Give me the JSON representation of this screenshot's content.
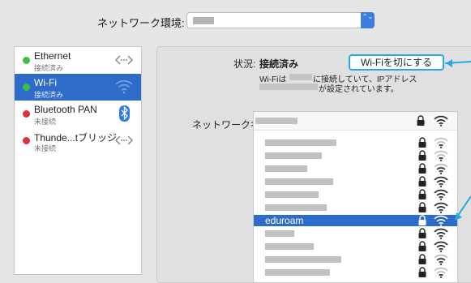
{
  "location": {
    "label": "ネットワーク環境:",
    "stepper_glyph": "⌃⌄"
  },
  "services": [
    {
      "name": "Ethernet",
      "status": "接続済み",
      "dot_color": "#3fbf3f",
      "icon": "ethernet-arrows-icon"
    },
    {
      "name": "Wi-Fi",
      "status": "接続済み",
      "dot_color": "#3fbf3f",
      "icon": "wifi-icon"
    },
    {
      "name": "Bluetooth PAN",
      "status": "未接続",
      "dot_color": "#e0313b",
      "icon": "bluetooth-icon"
    },
    {
      "name": "Thunde...tブリッジ",
      "status": "未接続",
      "dot_color": "#e0313b",
      "icon": "ethernet-arrows-icon"
    }
  ],
  "detail": {
    "status_label": "状況:",
    "status_value": "接続済み",
    "toggle_button": "Wi-Fiを切にする",
    "desc_prefix": "Wi-Fiは",
    "desc_mid": "に接続していて、IPアドレス",
    "desc_end": "が設定されています。",
    "network_name_label": "ネットワーク名"
  },
  "network_list": {
    "highlighted_network": "eduroam"
  },
  "colors": {
    "accent": "#2f6bc9",
    "callout": "#2aa6e0"
  }
}
